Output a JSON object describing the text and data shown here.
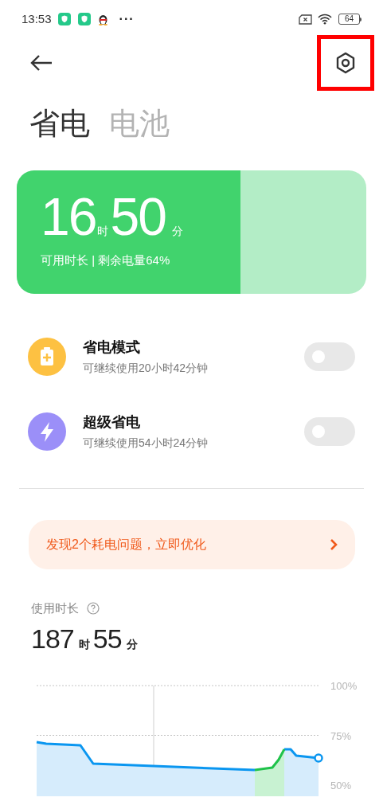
{
  "status_bar": {
    "time": "13:53",
    "more": "···",
    "battery": "64"
  },
  "header": {
    "settings_highlighted": true
  },
  "title_tabs": [
    {
      "label": "省电",
      "selected": true
    },
    {
      "label": "电池",
      "selected": false
    }
  ],
  "battery_card": {
    "hours": "16",
    "hours_unit": "时",
    "minutes": "50",
    "minutes_unit": "分",
    "caption": "可用时长 | 剩余电量64%",
    "level": 0.64
  },
  "modes": [
    {
      "kind": "battery",
      "title": "省电模式",
      "subtitle": "可继续使用20小时42分钟",
      "on": false
    },
    {
      "kind": "bolt",
      "title": "超级省电",
      "subtitle": "可继续使用54小时24分钟",
      "on": false
    }
  ],
  "banner": {
    "text": "发现2个耗电问题，立即优化"
  },
  "usage": {
    "label": "使用时长",
    "hours": "187",
    "hours_unit": "时",
    "minutes": "55",
    "minutes_unit": "分",
    "y_axis_labels": [
      "100%",
      "75%",
      "50%"
    ]
  }
}
